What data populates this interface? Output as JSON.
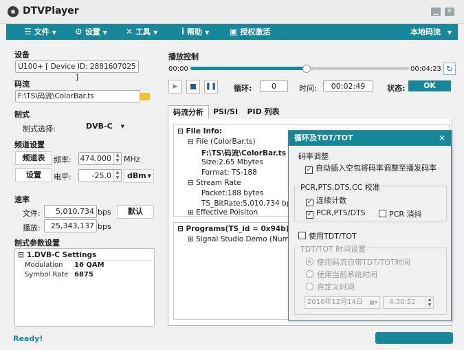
{
  "window": {
    "title": "DTVPlayer",
    "min": "▁",
    "close": "✕"
  },
  "menu": {
    "file": "文件",
    "settings": "设置",
    "tools": "工具",
    "help": "帮助",
    "activate": "授权激活",
    "local_stream": "本地码流"
  },
  "left": {
    "device_label": "设备",
    "device_value": "U100+ [ Device ID: 2881607025 ]",
    "stream_label": "码流",
    "stream_path": "F:\\TS\\码流\\ColorBar.ts",
    "system_label": "制式",
    "system_select_label": "制式选择:",
    "system_value": "DVB-C",
    "freq_section": "频道设置",
    "channel_table_btn": "频道表",
    "freq_label": "频率:",
    "freq_value": "474.000",
    "freq_unit": "MHz",
    "settings_btn": "设置",
    "level_label": "电平:",
    "level_value": "-25.0",
    "level_unit": "dBm",
    "rate_section": "速率",
    "file_rate_label": "文件:",
    "file_rate_value": "5,010,734",
    "file_rate_unit": "bps",
    "default_btn": "默认",
    "play_rate_label": "播放:",
    "play_rate_value": "25,343,137",
    "play_rate_unit": "bps",
    "params_section": "制式参数设置",
    "params_group": "1.DVB-C Settings",
    "params": [
      {
        "key": "Modulation",
        "value": "16 QAM"
      },
      {
        "key": "Symbol Rate",
        "value": "6875"
      }
    ]
  },
  "play": {
    "section": "播放控制",
    "time_start": "00:00",
    "time_end": "00:04:23",
    "progress": 0.53,
    "loop_label": "循环:",
    "loop_value": "0",
    "time_label": "时间:",
    "time_value": "00:02:49",
    "status_label": "状态:",
    "status_value": "OK"
  },
  "tabs": [
    "码流分析",
    "PSI/SI",
    "PID 列表"
  ],
  "tree": {
    "file_info": "File Info:",
    "file": "File (ColorBar.ts)",
    "path": "F:\\TS\\码流\\ColorBar.ts",
    "size": "Size:2.65 Mbytes",
    "format": "Format: TS-188",
    "stream_rate": "Stream Rate",
    "packet": "Packet:188 bytes",
    "ts_bitrate": "TS_BitRate:5,010,734 bps",
    "effective": "Effective Poisiton",
    "programs": "Programs(TS_id = 0x94b)",
    "program1": "Signal Studio Demo (Num=1"
  },
  "dialog": {
    "title": "循环及TDT/TOT",
    "close": "✕",
    "rate_group": "码率调整",
    "auto_insert": "自动插入空包将码率调整至播发码率",
    "pcr_group": "PCR,PTS,DTS,CC 校准",
    "continuous": "连续计数",
    "pcr_pts_dts": "PCR,PTS/DTS",
    "pcr_jitter": "PCR 消抖",
    "use_tdt": "使用TDT/TOT",
    "tdt_group": "TDT/TOT 时间设置",
    "opt_stream": "使用码流自带TDT/TOT时间",
    "opt_system": "使用当前系统时间",
    "opt_custom": "自定义时间",
    "date_value": "2016年12月14日",
    "time_value": "4:30:52"
  },
  "status": {
    "ready": "Ready!"
  },
  "colors": {
    "accent": "#17879a",
    "ok": "#17879a"
  }
}
